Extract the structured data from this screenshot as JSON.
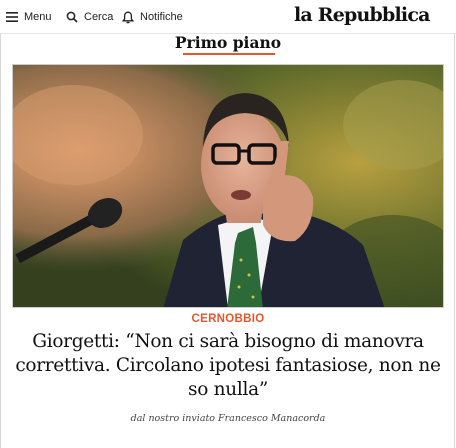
{
  "topbar": {
    "menu_label": "Menu",
    "search_label": "Cerca",
    "notifications_label": "Notifiche",
    "logo_text": "la Repubblica"
  },
  "section": {
    "title": "Primo piano",
    "accent_color": "#e4572e"
  },
  "article": {
    "kicker": "CERNOBBIO",
    "headline": "Giorgetti: “Non ci sarà bisogno di manovra correttiva. Circolano ipotesi fantasiose, non ne so nulla”",
    "byline": "dal nostro inviato Francesco Manacorda",
    "image_icon": "photo-of-speaker"
  }
}
